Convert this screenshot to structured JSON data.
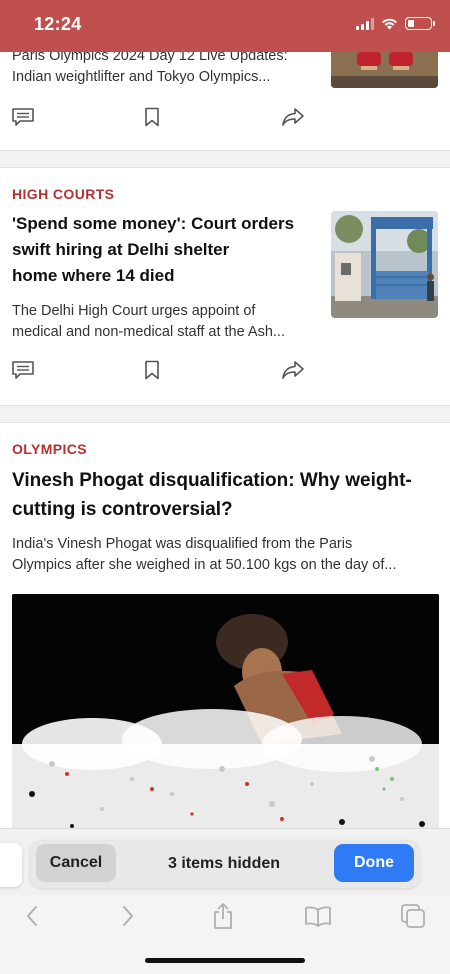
{
  "status_bar": {
    "time": "12:24",
    "accent_color": "#c0504d"
  },
  "articles": [
    {
      "headline_lines": [
        "Paris Olympics 2024 Day 12 Live Updates:",
        "Indian weightlifter and Tokyo Olympics..."
      ],
      "thumbnail": "athlete-legs-photo"
    },
    {
      "category": "HIGH COURTS",
      "headline_lines": [
        "'Spend some money': Court orders",
        "swift hiring at Delhi shelter",
        "home where 14 died"
      ],
      "summary_lines": [
        "The Delhi High Court urges appoint of",
        "medical and non-medical staff at the Ash..."
      ],
      "thumbnail": "shelter-gate-photo"
    },
    {
      "category": "OLYMPICS",
      "headline_lines": [
        "Vinesh Phogat disqualification: Why weight-",
        "cutting is controversial?"
      ],
      "summary_lines": [
        "India's Vinesh Phogat was disqualified from the Paris",
        "Olympics after she weighed in at 50.100 kgs on the day of..."
      ],
      "image": "wrestler-photo"
    }
  ],
  "article_actions": {
    "comment_icon": "comment-icon",
    "bookmark_icon": "bookmark-icon",
    "share_icon": "share-icon"
  },
  "hide_bar": {
    "cancel_label": "Cancel",
    "status_text": "3 items hidden",
    "done_label": "Done",
    "done_color": "#2f7bf6"
  },
  "toolbar": {
    "icons": [
      "back-icon",
      "forward-icon",
      "share-icon",
      "bookmarks-icon",
      "tabs-icon"
    ]
  },
  "colors": {
    "category": "#b5312f"
  }
}
